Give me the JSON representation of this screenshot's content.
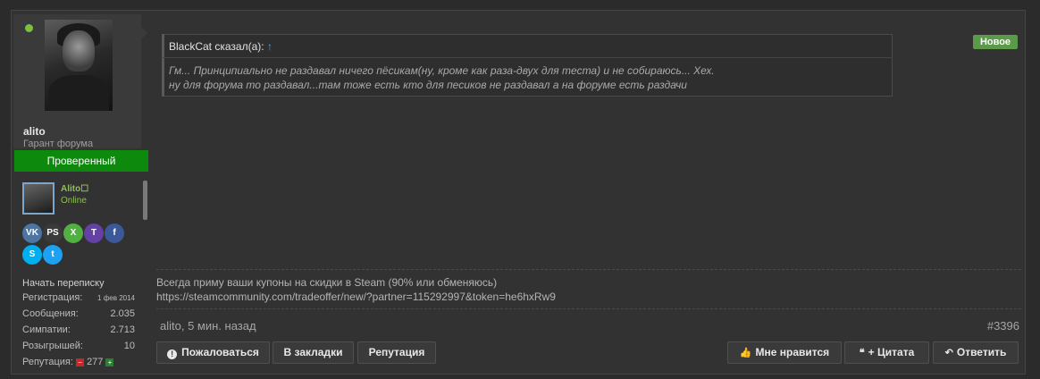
{
  "user": {
    "name": "alito",
    "title": "Гарант форума",
    "verified_label": "Проверенный",
    "card_name": "Alito☐",
    "card_status": "Online",
    "socials": [
      {
        "icon": "vk-icon",
        "text": "VK",
        "color": "#4c75a3"
      },
      {
        "icon": "playstation-icon",
        "text": "PS",
        "color": "#3a3a3a"
      },
      {
        "icon": "xbox-icon",
        "text": "X",
        "color": "#52b043"
      },
      {
        "icon": "twitch-icon",
        "text": "T",
        "color": "#6441a5"
      },
      {
        "icon": "facebook-icon",
        "text": "f",
        "color": "#3b5998"
      },
      {
        "icon": "skype-icon",
        "text": "S",
        "color": "#00aff0"
      },
      {
        "icon": "twitter-icon",
        "text": "t",
        "color": "#1da1f2"
      }
    ],
    "start_conversation": "Начать переписку",
    "stats": {
      "registration_label": "Регистрация:",
      "registration_value": "1 фев 2014",
      "messages_label": "Сообщения:",
      "messages_value": "2.035",
      "sympathies_label": "Симпатии:",
      "sympathies_value": "2.713",
      "giveaways_label": "Розыгрышей:",
      "giveaways_value": "10",
      "reputation_label": "Репутация:",
      "reputation_value": "277"
    }
  },
  "post": {
    "badge_new": "Новое",
    "quote": {
      "author": "BlackCat сказал(а):",
      "arrow": "↑",
      "line1": "Гм... Принципиально не раздавал ничего пёсикам(ну, кроме как раза-двух для теста) и не собираюсь... Хех.",
      "line2": "ну для форума то раздавал...там тоже есть кто для песиков не раздавал а на форуме есть раздачи"
    },
    "signature": {
      "line1": "Всегда приму ваши купоны на скидки в Steam (90% или обменяюсь)",
      "line2": "https://steamcommunity.com/tradeoffer/new/?partner=115292997&token=he6hxRw9"
    },
    "meta": "alito, 5 мин. назад",
    "number": "#3396"
  },
  "actions": {
    "report": "Пожаловаться",
    "bookmark": "В закладки",
    "reputation": "Репутация",
    "like": "Мне нравится",
    "quote": "+ Цитата",
    "reply": "Ответить"
  }
}
